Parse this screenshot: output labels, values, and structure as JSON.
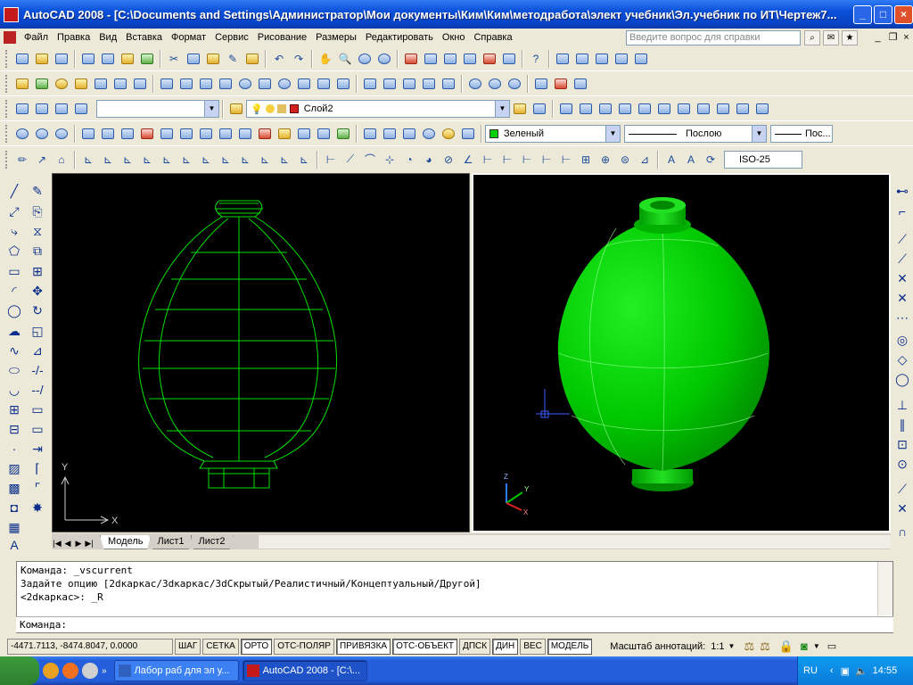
{
  "window": {
    "title": "AutoCAD 2008 - [C:\\Documents and Settings\\Администратор\\Мои документы\\Ким\\Ким\\методработа\\элект учебник\\Эл.учебник по ИТ\\Чертеж7...",
    "minimize": "_",
    "maximize": "□",
    "close": "×"
  },
  "menu": {
    "items": [
      "Файл",
      "Правка",
      "Вид",
      "Вставка",
      "Формат",
      "Сервис",
      "Рисование",
      "Размеры",
      "Редактировать",
      "Окно",
      "Справка"
    ],
    "help_placeholder": "Введите вопрос для справки"
  },
  "toolbars": {
    "layer_name": "Слой2",
    "color": "Зеленый",
    "linetype": "Послою",
    "lineweight": "Пос...",
    "dimstyle": "ISO-25"
  },
  "viewports": {
    "left_ucs_y": "Y",
    "left_ucs_x": "X",
    "right_ucs_z": "Z",
    "right_ucs_y": "Y",
    "right_ucs_x": "X"
  },
  "layout_tabs": [
    "Модель",
    "Лист1",
    "Лист2"
  ],
  "command": {
    "lines": [
      "Команда: _vscurrent",
      "Задайте опцию [2dкаркас/3dкаркас/3dСкрытый/Реалистичный/Концептуальный/Другой]",
      "<2dкаркас>: _R"
    ],
    "prompt": "Команда:"
  },
  "status": {
    "coords": "-4471.7113, -8474.8047, 0.0000",
    "buttons": [
      "ШАГ",
      "СЕТКА",
      "ОРТО",
      "ОТС-ПОЛЯР",
      "ПРИВЯЗКА",
      "ОТС-ОБЪЕКТ",
      "ДПСК",
      "ДИН",
      "ВЕС",
      "МОДЕЛЬ"
    ],
    "annotation_scale_label": "Масштаб аннотаций:",
    "annotation_scale": "1:1"
  },
  "taskbar": {
    "tasks": [
      "Лабор  раб для эл у...",
      "AutoCAD 2008 - [C:\\..."
    ],
    "language": "RU",
    "time": "14:55"
  },
  "colors": {
    "wireframe": "#00e000",
    "shaded": "#00cc00",
    "viewport_bg": "#000000",
    "xp_blue": "#245edb"
  }
}
